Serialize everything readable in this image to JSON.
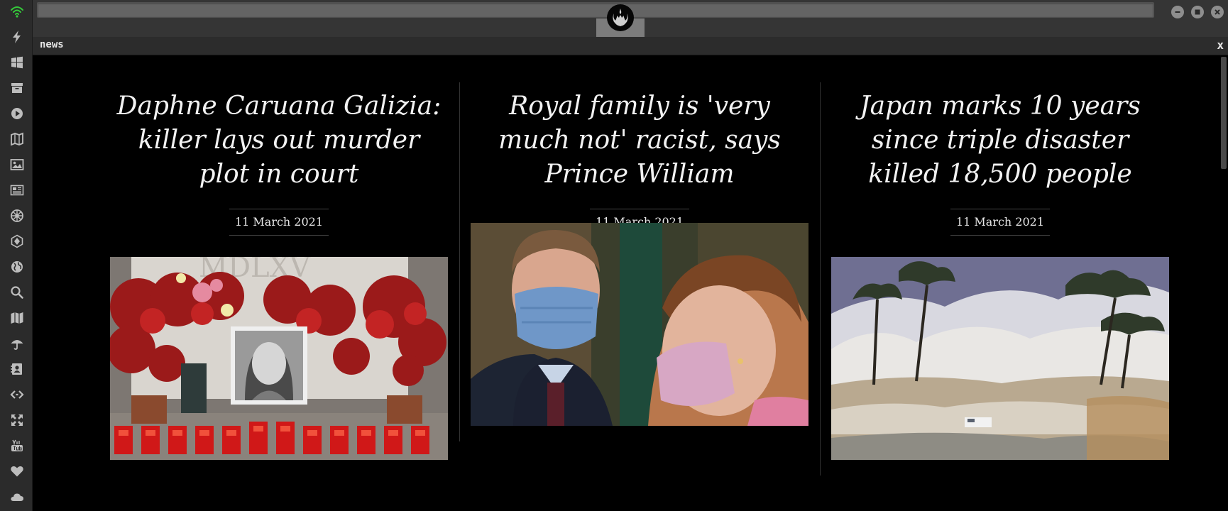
{
  "window": {
    "emblem_icon": "rebel-alliance-icon",
    "controls": [
      "minimize-icon",
      "maximize-icon",
      "close-icon"
    ]
  },
  "dock": {
    "items": [
      "wifi-icon",
      "lightning-icon",
      "windows-icon",
      "archive-icon",
      "play-icon",
      "map-book-icon",
      "image-icon",
      "newspaper-icon",
      "empire-icon",
      "hexagon-icon",
      "globe-icon",
      "search-icon",
      "map-icon",
      "umbrella-icon",
      "contacts-icon",
      "code-icon",
      "expand-icon",
      "youtube-icon",
      "heart-icon",
      "cloud-icon"
    ],
    "wifi_color": "#35c93a",
    "icon_color": "#bdbdbd"
  },
  "panel": {
    "title": "news",
    "close_label": "x"
  },
  "articles": [
    {
      "title": "Daphne Caruana Galizia: killer lays out murder plot in court",
      "date": "11 March 2021",
      "image_icon": "memorial-photo"
    },
    {
      "title": "Royal family is 'very much not' racist, says Prince William",
      "date": "11 March 2021",
      "image_icon": "royals-masks-photo"
    },
    {
      "title": "Japan marks 10 years since triple disaster killed 18,500 people",
      "date": "11 March 2021",
      "image_icon": "tsunami-photo"
    }
  ]
}
